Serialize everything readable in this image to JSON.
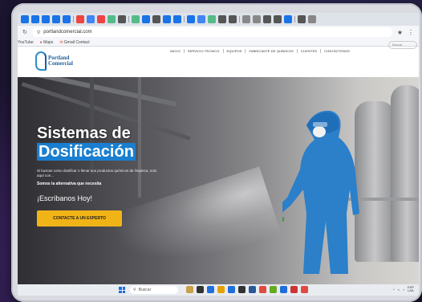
{
  "browser": {
    "url": "portlandcomercial.com",
    "bookmarks": [
      "YouTube",
      "Maps",
      "Gmail Contact"
    ],
    "tab_colors": [
      "#1a73e8",
      "#1a73e8",
      "#1a73e8",
      "#1a73e8",
      "#1a73e8",
      "#e44",
      "#4285f4",
      "#e44",
      "#5b8",
      "#555",
      "#5b8",
      "#1a73e8",
      "#555",
      "#1a73e8",
      "#1a73e8",
      "#1a73e8",
      "#4285f4",
      "#5b8",
      "#555",
      "#555",
      "#888",
      "#888",
      "#555",
      "#555",
      "#1a73e8",
      "#555",
      "#888"
    ]
  },
  "site": {
    "logo_line1": "Portland",
    "logo_line2": "Comercial",
    "nav": [
      "INICIO",
      "SERVICIO TÉCNICO",
      "EQUIPOS",
      "FABRICANTE DE QUÍMICOS",
      "CLIENTES",
      "CONTÁCTENOS"
    ],
    "search_placeholder": "Buscar"
  },
  "hero": {
    "title_line1": "Sistemas de",
    "title_line2": "Dosificación",
    "subtitle": "Si buscas como dosificar o llenar sus productos químicos de limpieza, solo aquí con...",
    "highlight": "Somos la alternativa que necesita",
    "prompt": "¡Escríbanos Hoy!",
    "cta_label": "CONTACTE A UN EXPERTO"
  },
  "taskbar": {
    "search_label": "Buscar",
    "app_colors": [
      "#c8a04a",
      "#333",
      "#1e6fd9",
      "#e6a100",
      "#1e6fd9",
      "#333",
      "#2b5797",
      "#e04a3f",
      "#6a2",
      "#1e6fd9",
      "#c33",
      "#e04a3f"
    ],
    "clock_time": "ESP",
    "clock_date": "LAA"
  }
}
